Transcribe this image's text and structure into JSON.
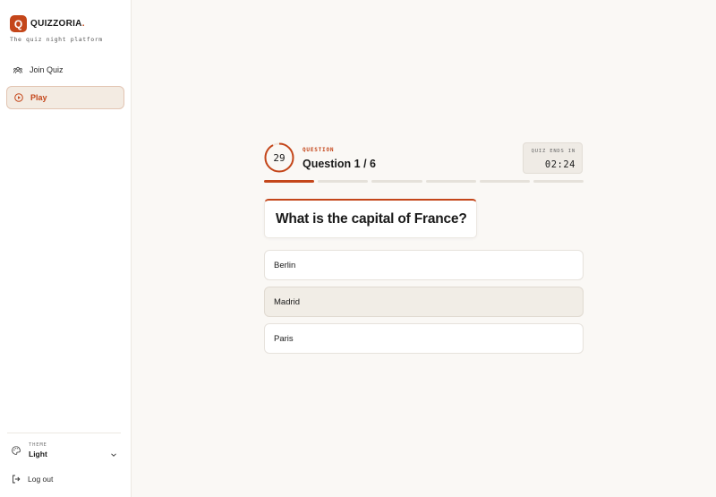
{
  "brand": {
    "logo_letter": "Q",
    "name": "QUIZZORIA",
    "dot": ".",
    "tagline": "The quiz night platform"
  },
  "nav": {
    "items": [
      {
        "label": "Join Quiz",
        "icon": "users-icon"
      },
      {
        "label": "Play",
        "icon": "play-circle-icon",
        "active": true
      }
    ]
  },
  "theme": {
    "label": "THEME",
    "value": "Light",
    "icon": "palette-icon"
  },
  "logout": {
    "label": "Log out",
    "icon": "logout-icon"
  },
  "quiz": {
    "timer_seconds": "29",
    "kicker": "QUESTION",
    "question_number": "Question 1 / 6",
    "ends_label": "QUIZ ENDS IN",
    "ends_time": "02:24",
    "progress": {
      "current": 1,
      "total": 6
    },
    "question": "What is the capital of France?",
    "answers": [
      {
        "label": "Berlin",
        "selected": false
      },
      {
        "label": "Madrid",
        "selected": true
      },
      {
        "label": "Paris",
        "selected": false
      }
    ]
  },
  "colors": {
    "accent": "#c4461a",
    "background": "#faf8f5",
    "selected_answer": "#f1ede6"
  }
}
